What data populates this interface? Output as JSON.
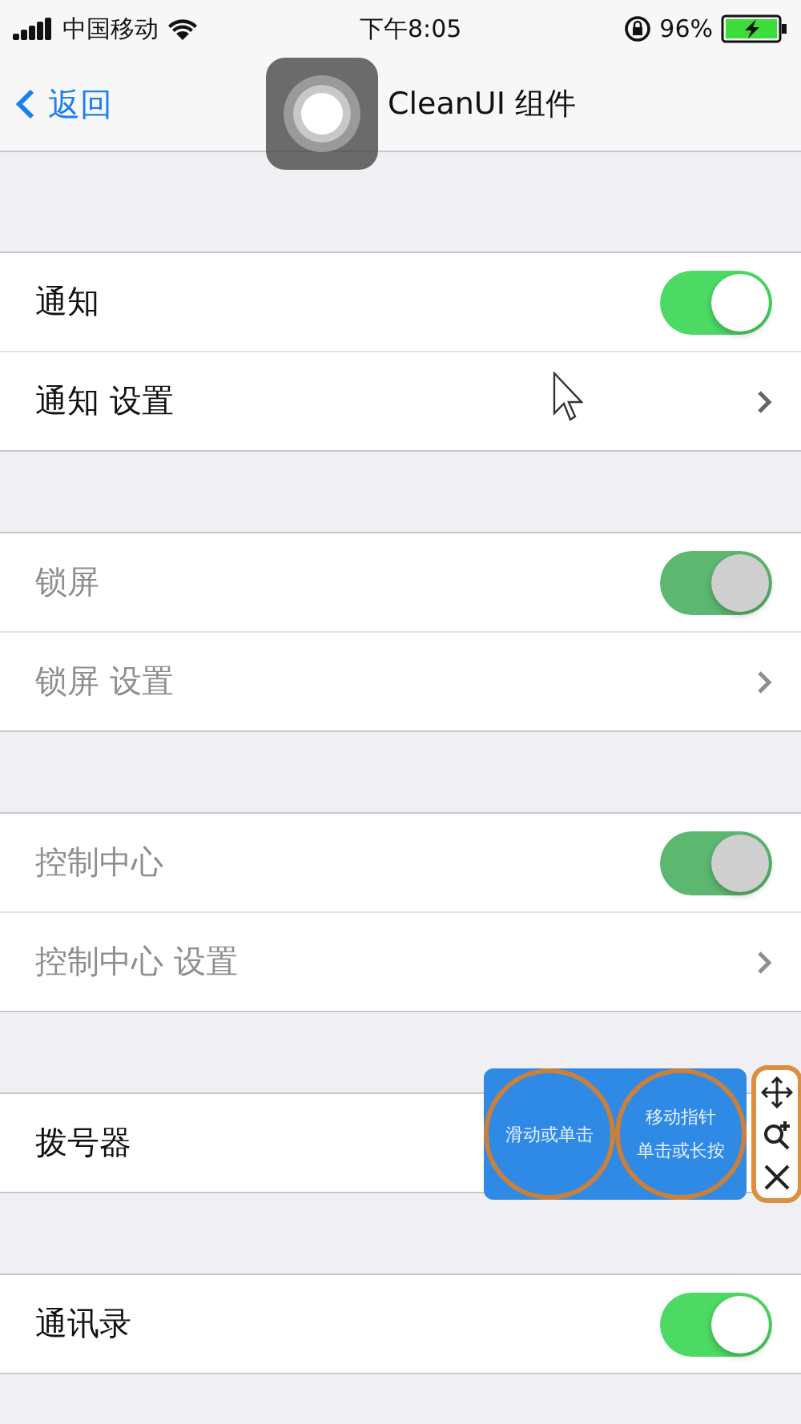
{
  "status_bar": {
    "carrier": "中国移动",
    "time": "下午8:05",
    "battery": "96%"
  },
  "nav": {
    "back": "返回",
    "title": "CleanUI 组件"
  },
  "groups": [
    {
      "rows": [
        {
          "kind": "switch",
          "label": "通知",
          "on": true,
          "disabled": false
        },
        {
          "kind": "link",
          "label": "通知 设置",
          "disabled": false
        }
      ]
    },
    {
      "rows": [
        {
          "kind": "switch",
          "label": "锁屏",
          "on": true,
          "disabled": true
        },
        {
          "kind": "link",
          "label": "锁屏 设置",
          "disabled": true
        }
      ]
    },
    {
      "rows": [
        {
          "kind": "switch",
          "label": "控制中心",
          "on": true,
          "disabled": true
        },
        {
          "kind": "link",
          "label": "控制中心 设置",
          "disabled": true
        }
      ]
    },
    {
      "rows": [
        {
          "kind": "plain",
          "label": "拨号器",
          "disabled": false
        }
      ]
    },
    {
      "rows": [
        {
          "kind": "switch",
          "label": "通讯录",
          "on": true,
          "disabled": false
        }
      ]
    }
  ],
  "floating_panel": {
    "buttons": [
      {
        "lines": [
          "滑动或单击"
        ]
      },
      {
        "lines": [
          "移动指针",
          "单击或长按"
        ]
      }
    ]
  }
}
